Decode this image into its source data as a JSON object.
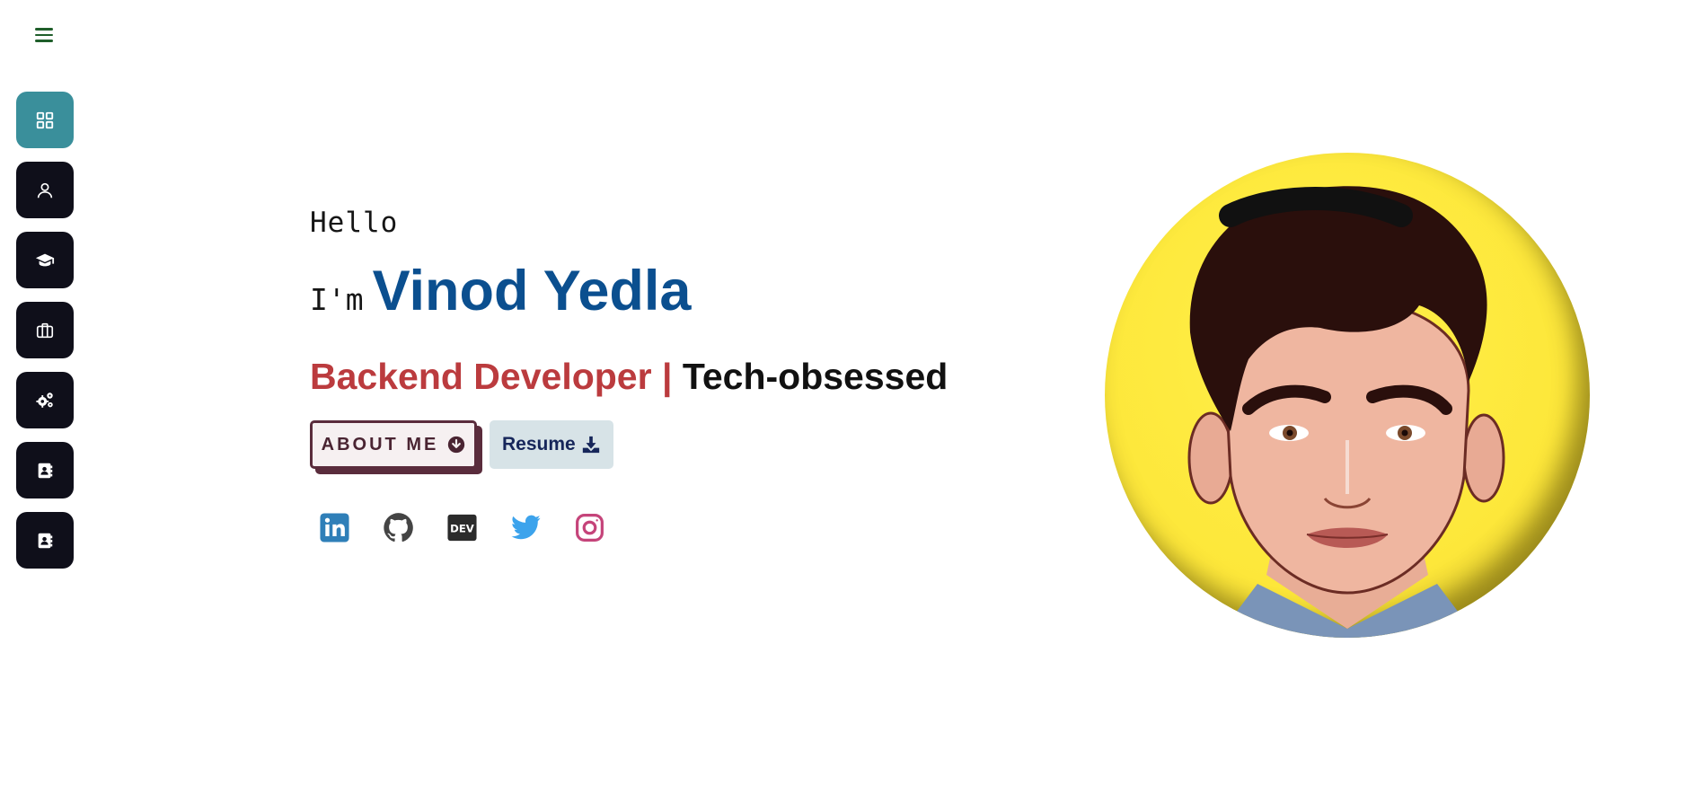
{
  "nav": {
    "items": [
      {
        "name": "dashboard",
        "icon": "grid-icon",
        "active": true
      },
      {
        "name": "about",
        "icon": "user-icon",
        "active": false
      },
      {
        "name": "education",
        "icon": "graduation-cap-icon",
        "active": false
      },
      {
        "name": "experience",
        "icon": "briefcase-icon",
        "active": false
      },
      {
        "name": "skills",
        "icon": "gears-icon",
        "active": false
      },
      {
        "name": "contact",
        "icon": "address-book-icon",
        "active": false
      },
      {
        "name": "contact-2",
        "icon": "address-book-icon",
        "active": false
      }
    ]
  },
  "hero": {
    "greeting": "Hello",
    "im": "I'm",
    "name": "Vinod Yedla",
    "role": "Backend Developer",
    "separator": "|",
    "tagline": "Tech-obsessed",
    "about_button": "ABOUT ME",
    "resume_button": "Resume"
  },
  "socials": [
    {
      "name": "linkedin",
      "icon": "linkedin-icon",
      "color": "#0a66c2"
    },
    {
      "name": "github",
      "icon": "github-icon",
      "color": "#333333"
    },
    {
      "name": "dev",
      "icon": "dev-icon",
      "color": "#222222"
    },
    {
      "name": "twitter",
      "icon": "twitter-icon",
      "color": "#1da1f2"
    },
    {
      "name": "instagram",
      "icon": "instagram-icon",
      "color": "#c13584"
    }
  ],
  "colors": {
    "accent": "#3a8f9b",
    "name": "#0b4f8f",
    "role": "#bb3b3e",
    "avatar_bg": "#fde73a"
  }
}
